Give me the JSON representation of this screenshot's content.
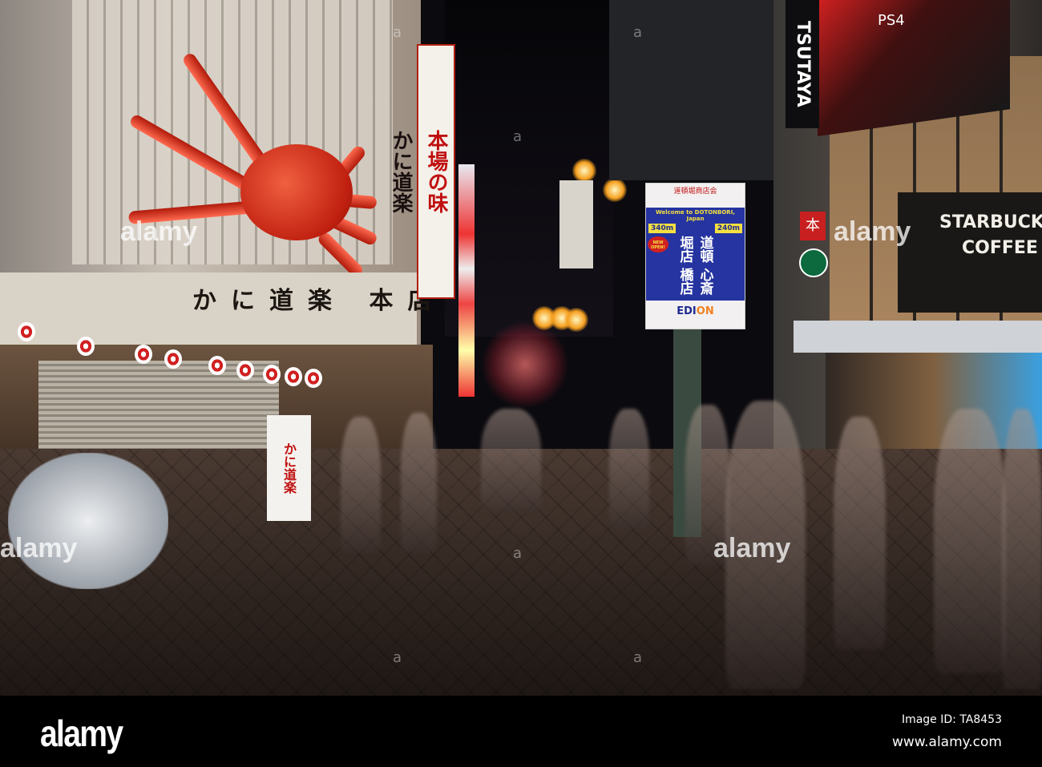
{
  "scene": {
    "crab_restaurant": {
      "vertical_sign_top": "本場の味",
      "vertical_sign_bottom": "かに道楽",
      "awning_text": "かに道楽 本店",
      "standee_text": "かに道楽"
    },
    "banner": {
      "header": "道頓堀商店会",
      "welcome": "Welcome to DOTONBORI, Japan",
      "left_distance": "340m",
      "right_distance": "240m",
      "new_open": "NEW OPEN!",
      "left_store": "心斎橋店",
      "right_store": "道頓堀店",
      "brand_main": "EDI",
      "brand_accent": "ON"
    },
    "right_side": {
      "tsutaya": "TSUTAYA",
      "screen_brand": "PS4",
      "starbucks_line1": "STARBUCKS",
      "starbucks_line2": "COFFEE",
      "red_sign": "本"
    },
    "colors": {
      "banner_blue": "#2534a0",
      "crab_red": "#c02010",
      "starbucks_green": "#0c6a3e"
    }
  },
  "watermark": {
    "mark": "alamy",
    "footer_logo": "alamy",
    "image_id": "Image ID: TA8453",
    "website": "www.alamy.com"
  }
}
